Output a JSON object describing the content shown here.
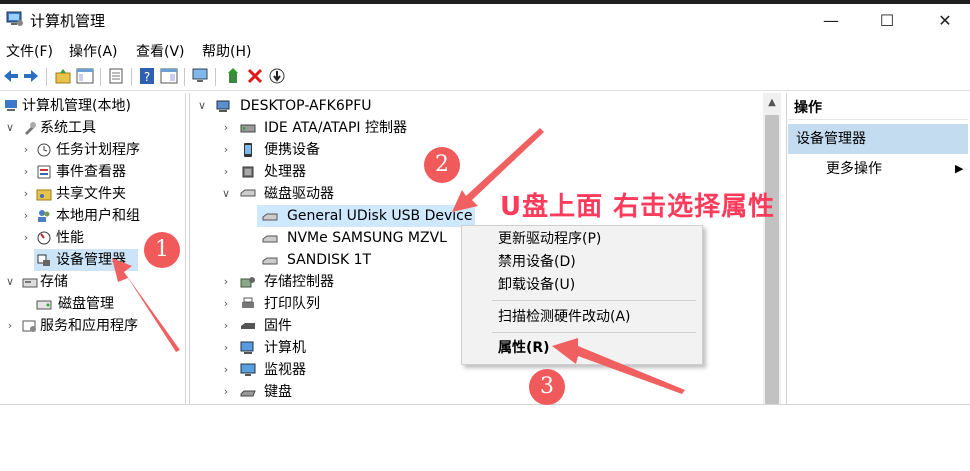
{
  "window": {
    "title": "计算机管理",
    "min_glyph": "—",
    "max_glyph": "☐",
    "close_glyph": "✕"
  },
  "menu": [
    "文件(F)",
    "操作(A)",
    "查看(V)",
    "帮助(H)"
  ],
  "toolbar_icons": [
    "back-icon",
    "forward-icon",
    "up-folder-icon",
    "console-tree-icon",
    "properties-icon",
    "help-icon",
    "show-hide-icon",
    "monitor-icon",
    "update-driver-icon",
    "uninstall-icon",
    "scan-icon"
  ],
  "left_tree": [
    {
      "label": "计算机管理(本地)",
      "icon": "computer-icon"
    },
    {
      "label": "系统工具",
      "icon": "tools-icon"
    },
    {
      "label": "任务计划程序",
      "icon": "clock-icon"
    },
    {
      "label": "事件查看器",
      "icon": "event-icon"
    },
    {
      "label": "共享文件夹",
      "icon": "folder-share-icon"
    },
    {
      "label": "本地用户和组",
      "icon": "users-icon"
    },
    {
      "label": "性能",
      "icon": "performance-icon"
    },
    {
      "label": "设备管理器",
      "icon": "device-manager-icon"
    },
    {
      "label": "存储",
      "icon": "storage-icon"
    },
    {
      "label": "磁盘管理",
      "icon": "disk-icon"
    },
    {
      "label": "服务和应用程序",
      "icon": "services-icon"
    }
  ],
  "device_tree": [
    {
      "label": "DESKTOP-AFK6PFU"
    },
    {
      "label": "IDE ATA/ATAPI 控制器"
    },
    {
      "label": "便携设备"
    },
    {
      "label": "处理器"
    },
    {
      "label": "磁盘驱动器"
    },
    {
      "label": "General UDisk USB Device"
    },
    {
      "label": "NVMe SAMSUNG MZVL"
    },
    {
      "label": "SANDISK 1T"
    },
    {
      "label": "存储控制器"
    },
    {
      "label": "打印队列"
    },
    {
      "label": "固件"
    },
    {
      "label": "计算机"
    },
    {
      "label": "监视器"
    },
    {
      "label": "键盘"
    }
  ],
  "actions": {
    "header": "操作",
    "group": "设备管理器",
    "more": "更多操作"
  },
  "context_menu": [
    "更新驱动程序(P)",
    "禁用设备(D)",
    "卸载设备(U)",
    "扫描检测硬件改动(A)",
    "属性(R)"
  ],
  "annotation": {
    "text": "U盘上面  右击选择属性",
    "badges": [
      "1",
      "2",
      "3"
    ],
    "color": "#ff3b5c"
  }
}
